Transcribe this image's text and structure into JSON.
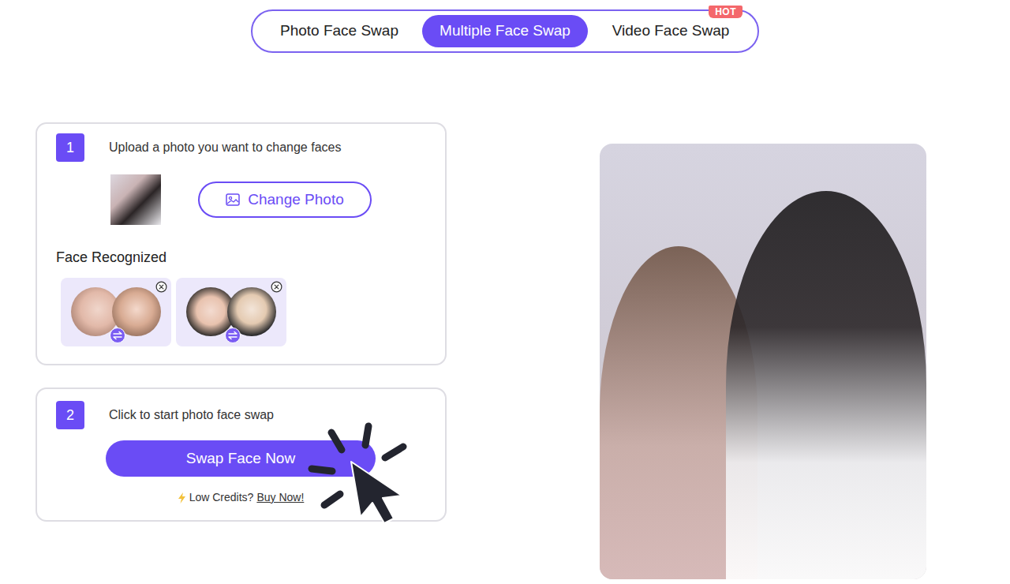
{
  "tabs": [
    {
      "label": "Photo Face Swap",
      "selected": false
    },
    {
      "label": "Multiple Face Swap",
      "selected": true
    },
    {
      "label": "Video Face Swap",
      "selected": false,
      "badge": "HOT"
    }
  ],
  "upload": {
    "number": "1",
    "title": "Upload a photo you want to change faces",
    "button": "Change Photo"
  },
  "faces": {
    "label": "Face Recognized",
    "pairs": [
      {},
      {}
    ]
  },
  "swap": {
    "number": "2",
    "title": "Click to start photo face swap",
    "button": "Swap Face Now",
    "note": "Low Credits?",
    "link": "Buy Now!"
  }
}
